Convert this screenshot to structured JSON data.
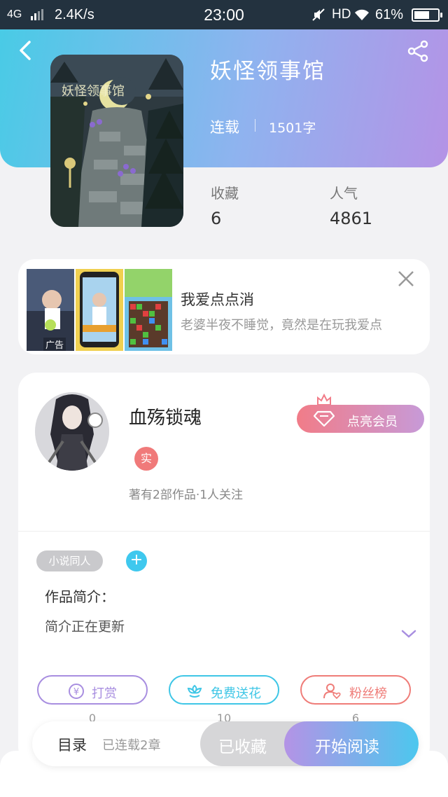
{
  "status_bar": {
    "network": "4G",
    "speed": "2.4K/s",
    "time": "23:00",
    "hd": "HD",
    "battery": "61%"
  },
  "book": {
    "title": "妖怪领事馆",
    "status": "连载",
    "words": "1501字",
    "stats": [
      {
        "label": "收藏",
        "value": "6"
      },
      {
        "label": "人气",
        "value": "4861"
      }
    ]
  },
  "ad": {
    "title": "我爱点点消",
    "description": "老婆半夜不睡觉，竟然是在玩我爱点",
    "badge": "广告"
  },
  "author": {
    "name": "血殇锁魂",
    "badge": "实",
    "meta": "著有2部作品·1人关注",
    "vip_label": "点亮会员"
  },
  "tags": {
    "chip": "小说同人",
    "add": "+"
  },
  "intro": {
    "heading": "作品简介：",
    "text": "简介正在更新"
  },
  "actions": [
    {
      "label": "打赏",
      "count": "0",
      "color": "#a88ee0"
    },
    {
      "label": "免费送花",
      "count": "10",
      "color": "#3ec6e6"
    },
    {
      "label": "粉丝榜",
      "count": "6",
      "color": "#ef7c78"
    }
  ],
  "bottom_bar": {
    "toc": "目录",
    "chapters": "已连载2章",
    "collected": "已收藏",
    "read": "开始阅读"
  },
  "colors": {
    "accent_blue": "#49cbe6",
    "accent_purple": "#b493e6",
    "accent_red": "#ef7c78"
  }
}
